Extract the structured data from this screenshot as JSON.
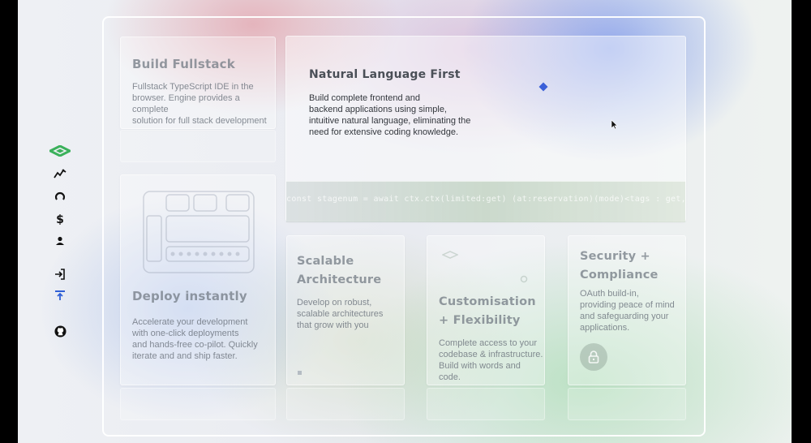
{
  "sidebar": {
    "icons": [
      "logo-icon",
      "activity-icon",
      "loop-icon",
      "dollar-icon",
      "user-icon",
      "login-icon",
      "upload-icon",
      "github-icon"
    ],
    "accent": "#2f5fd6",
    "logo_color": "#3bb15b"
  },
  "cards": {
    "build_fullstack": {
      "title": "Build Fullstack",
      "body": [
        "Fullstack TypeScript IDE in the",
        "browser. Engine provides a complete",
        "solution for full stack development"
      ]
    },
    "natural_language": {
      "title": "Natural Language First",
      "body": [
        "Build complete frontend and",
        "backend applications using simple,",
        "intuitive natural language, eliminating the",
        "need for extensive coding knowledge."
      ],
      "code": "const stagenum = await ctx.ctx(limited:get) (at:reservation)(mode)<tags : get, total:(ctx.add)> (request , endwinds.ts"
    },
    "deploy": {
      "title": "Deploy instantly",
      "body": [
        "Accelerate your development",
        "with one-click deployments",
        "and hands-free co-pilot. Quickly",
        "iterate and and ship faster."
      ]
    },
    "scalable": {
      "title": [
        "Scalable",
        "Architecture"
      ],
      "body": [
        "Develop on robust,",
        "scalable architectures",
        "that grow with you"
      ]
    },
    "customisation": {
      "title": [
        "Customisation",
        "+ Flexibility"
      ],
      "body": [
        "Complete access to your",
        "codebase & infrastructure.",
        "Build with words and code."
      ]
    },
    "security": {
      "title": [
        "Security +",
        "Compliance"
      ],
      "body": [
        "OAuth build-in,",
        "providing peace of mind",
        "and safeguarding your",
        "applications."
      ]
    }
  },
  "colors": {
    "diamond": "#3a5fd8",
    "frame": "#ffffff"
  }
}
